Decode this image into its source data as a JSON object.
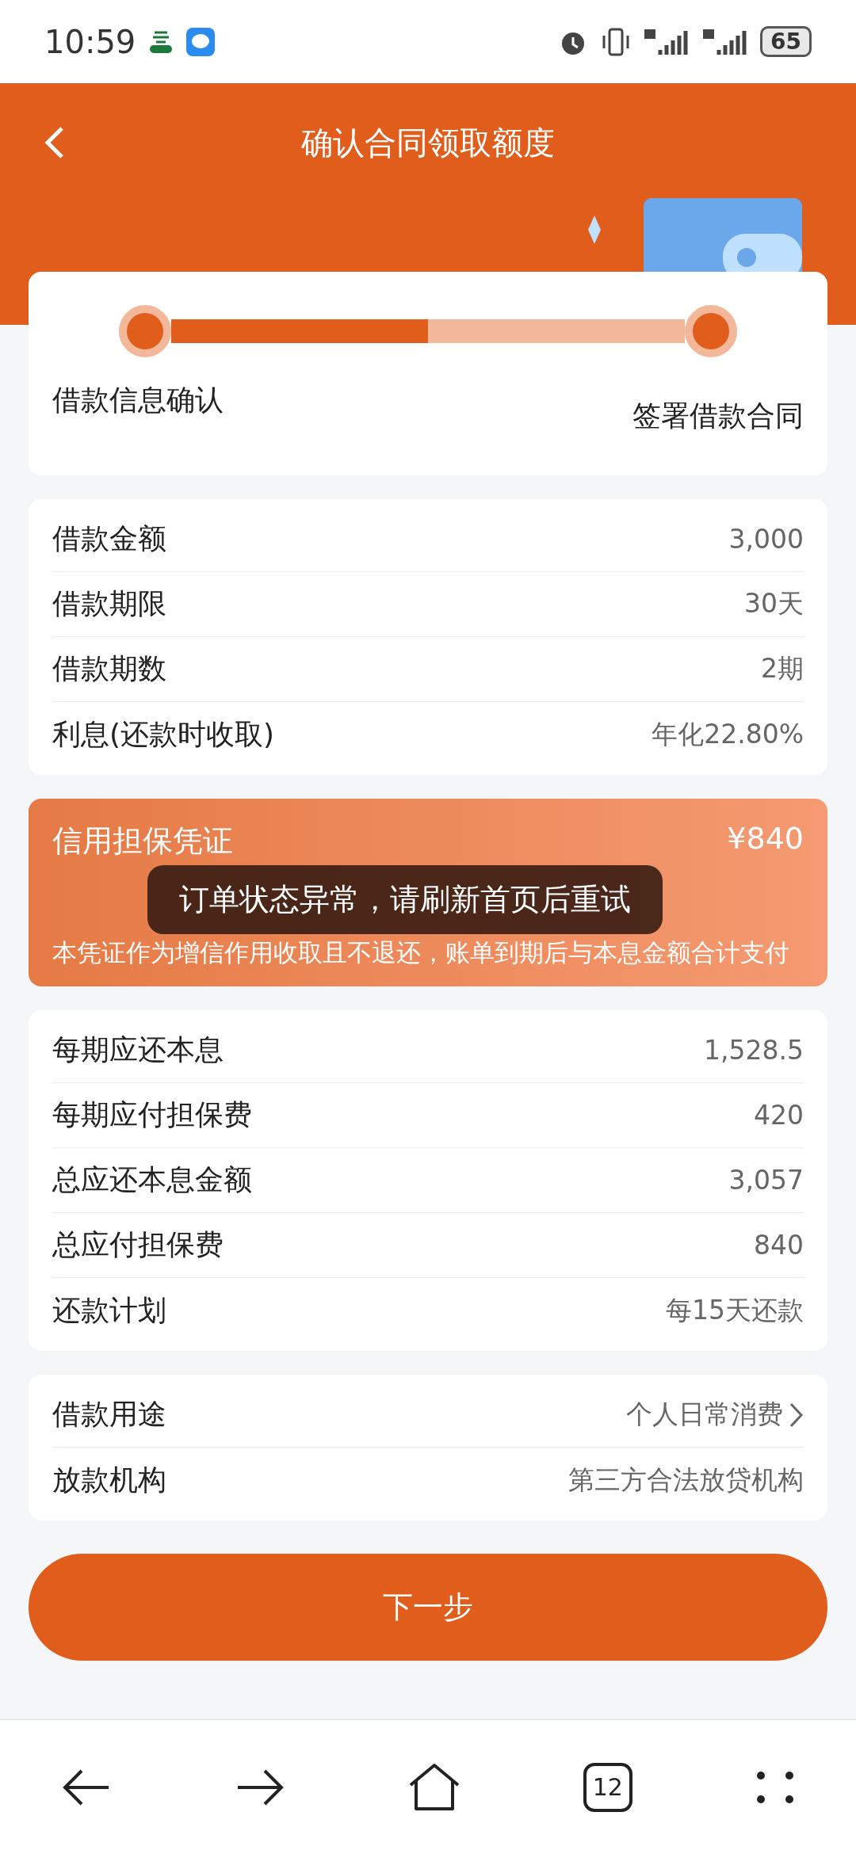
{
  "status_bar": {
    "time": "10:59",
    "battery": "65"
  },
  "header": {
    "title": "确认合同领取额度"
  },
  "steps": {
    "level": 0.5,
    "labels": [
      "借款信息确认",
      "签署借款合同"
    ]
  },
  "loan_details": [
    {
      "label": "借款金额",
      "value": "3,000"
    },
    {
      "label": "借款期限",
      "value": "30天"
    },
    {
      "label": "借款期数",
      "value": "2期"
    },
    {
      "label": "利息(还款时收取)",
      "value": "年化22.80%"
    }
  ],
  "guarantee": {
    "title": "信用担保凭证",
    "amount": "¥840",
    "description": "本凭证作为增信作用收取且不退还，账单到期后与本息金额合计支付"
  },
  "toast": "订单状态异常，请刷新首页后重试",
  "repayment": [
    {
      "label": "每期应还本息",
      "value": "1,528.5"
    },
    {
      "label": "每期应付担保费",
      "value": "420"
    },
    {
      "label": "总应还本息金额",
      "value": "3,057"
    },
    {
      "label": "总应付担保费",
      "value": "840"
    },
    {
      "label": "还款计划",
      "value": "每15天还款"
    }
  ],
  "other": [
    {
      "label": "借款用途",
      "value": "个人日常消费",
      "link": true
    },
    {
      "label": "放款机构",
      "value": "第三方合法放贷机构",
      "link": false
    }
  ],
  "next_button": "下一步",
  "browser_bar": {
    "tab_count": "12"
  }
}
